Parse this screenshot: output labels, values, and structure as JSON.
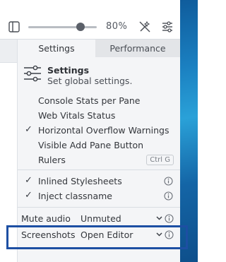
{
  "toolbar": {
    "zoom_value": "80%",
    "zoom_fraction": 0.76
  },
  "tabs": [
    {
      "label": "Settings",
      "active": true
    },
    {
      "label": "Performance",
      "active": false
    }
  ],
  "settings_header": {
    "title": "Settings",
    "subtitle": "Set global settings."
  },
  "options": [
    {
      "label": "Console Stats per Pane",
      "checked": false
    },
    {
      "label": "Web Vitals Status",
      "checked": false
    },
    {
      "label": "Horizontal Overflow Warnings",
      "checked": true
    },
    {
      "label": "Visible Add Pane Button",
      "checked": false
    },
    {
      "label": "Rulers",
      "checked": false,
      "shortcut": "Ctrl G"
    }
  ],
  "options2": [
    {
      "label": "Inlined Stylesheets",
      "checked": true
    },
    {
      "label": "Inject classname",
      "checked": true
    }
  ],
  "settings": [
    {
      "name": "Mute audio",
      "value": "Unmuted"
    },
    {
      "name": "Screenshots",
      "value": "Open Editor"
    }
  ],
  "colors": {
    "highlight": "#1d4fa3",
    "desktop": "#1a7fc0"
  }
}
